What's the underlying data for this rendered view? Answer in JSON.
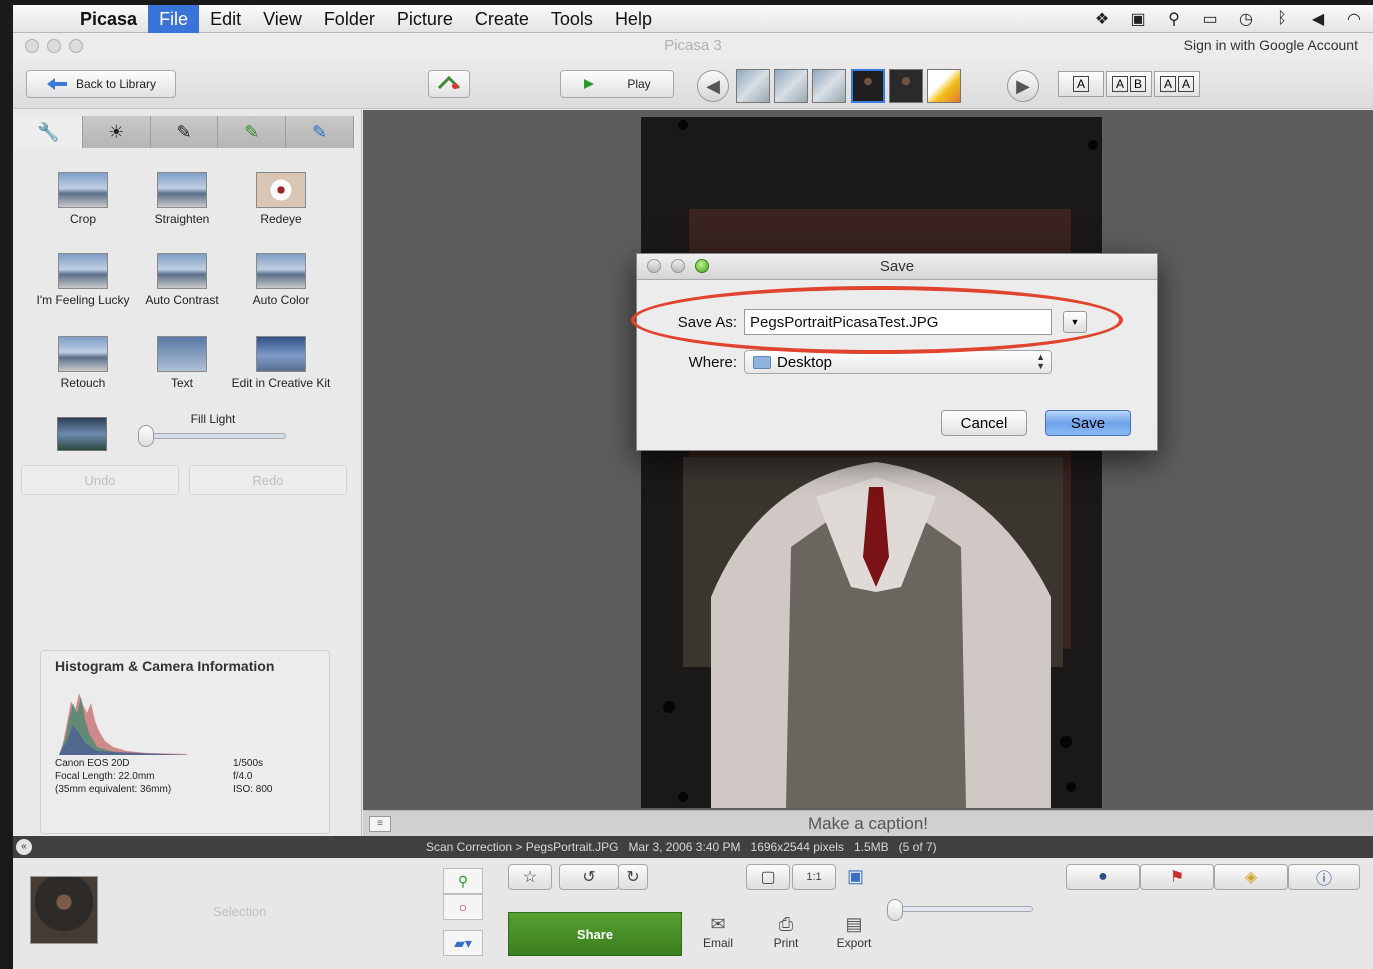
{
  "menubar": {
    "app": "Picasa",
    "items": [
      "File",
      "Edit",
      "View",
      "Folder",
      "Picture",
      "Create",
      "Tools",
      "Help"
    ],
    "active": "File",
    "status_icons": [
      "dropbox-icon",
      "activity-monitor-icon",
      "satellite-icon",
      "display-icon",
      "time-machine-icon",
      "bluetooth-icon",
      "volume-icon",
      "wifi-icon"
    ]
  },
  "window": {
    "title": "Picasa 3",
    "signin": "Sign in with Google Account"
  },
  "toolbar": {
    "back_label": "Back to Library",
    "play_label": "Play",
    "font_buttons": [
      [
        "A"
      ],
      [
        "A",
        "B"
      ],
      [
        "A",
        "A"
      ]
    ]
  },
  "edit_panel": {
    "tabs": [
      "wrench-icon",
      "sun-icon",
      "brush-icon",
      "green-brush-icon",
      "blue-brush-icon"
    ],
    "tools": [
      "Crop",
      "Straighten",
      "Redeye",
      "I'm Feeling Lucky",
      "Auto Contrast",
      "Auto Color",
      "Retouch",
      "Text",
      "Edit in Creative Kit"
    ],
    "fill_light_label": "Fill Light",
    "fill_light_value": 0,
    "undo_label": "Undo",
    "redo_label": "Redo"
  },
  "histogram": {
    "title": "Histogram & Camera Information",
    "camera": "Canon EOS 20D",
    "focal_length": "Focal Length: 22.0mm",
    "equivalent": "(35mm equivalent:  36mm)",
    "shutter": "1/500s",
    "aperture": "f/4.0",
    "iso": "ISO: 800"
  },
  "caption": {
    "placeholder": "Make a caption!"
  },
  "info_strip": {
    "path": "Scan Correction > PegsPortrait.JPG",
    "date": "Mar 3, 2006 3:40 PM",
    "dimensions": "1696x2544 pixels",
    "size": "1.5MB",
    "position": "(5 of 7)"
  },
  "tray": {
    "selection_label": "Selection",
    "share_label": "Share",
    "actions": [
      "Email",
      "Print",
      "Export"
    ]
  },
  "save_dialog": {
    "title": "Save",
    "save_as_label": "Save As:",
    "filename": "PegsPortraitPicasaTest.JPG",
    "where_label": "Where:",
    "where_value": "Desktop",
    "cancel_label": "Cancel",
    "save_label": "Save",
    "highlight_color": "#e0442f"
  }
}
